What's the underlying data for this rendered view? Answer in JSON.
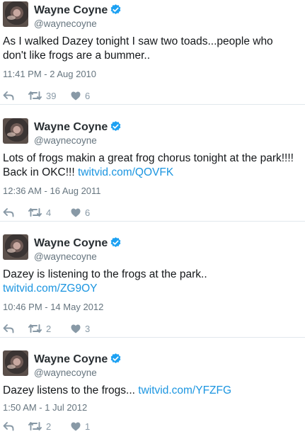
{
  "colors": {
    "link": "#1b95e0",
    "verified": "#1da1f2",
    "meta": "#66757f",
    "icon": "#8899a6",
    "divider": "#e1e8ed"
  },
  "icons": [
    "avatar",
    "verified-badge-icon",
    "reply-icon",
    "retweet-icon",
    "heart-icon"
  ],
  "tweets": [
    {
      "name": "Wayne Coyne",
      "handle": "@waynecoyne",
      "line1": "As I walked Dazey tonight I saw two toads...people who",
      "line2": "don't like frogs are a bummer..",
      "link": "",
      "time": "11:41 PM - 2 Aug 2010",
      "retweets": "39",
      "likes": "6"
    },
    {
      "name": "Wayne Coyne",
      "handle": "@waynecoyne",
      "line1": "Lots of frogs makin a great frog chorus tonight at the park!!!!",
      "line2": "Back in OKC!!! ",
      "link": "twitvid.com/QOVFK",
      "time": "12:36 AM - 16 Aug 2011",
      "retweets": "4",
      "likes": "6"
    },
    {
      "name": "Wayne Coyne",
      "handle": "@waynecoyne",
      "line1": "Dazey is listening to the frogs at the park..",
      "line2": "",
      "link": "twitvid.com/ZG9OY",
      "time": "10:46 PM - 14 May 2012",
      "retweets": "2",
      "likes": "3"
    },
    {
      "name": "Wayne Coyne",
      "handle": "@waynecoyne",
      "line1": "Dazey listens to the frogs... ",
      "line2": "",
      "link": "twitvid.com/YFZFG",
      "time": "1:50 AM - 1 Jul 2012",
      "retweets": "2",
      "likes": "1"
    }
  ]
}
